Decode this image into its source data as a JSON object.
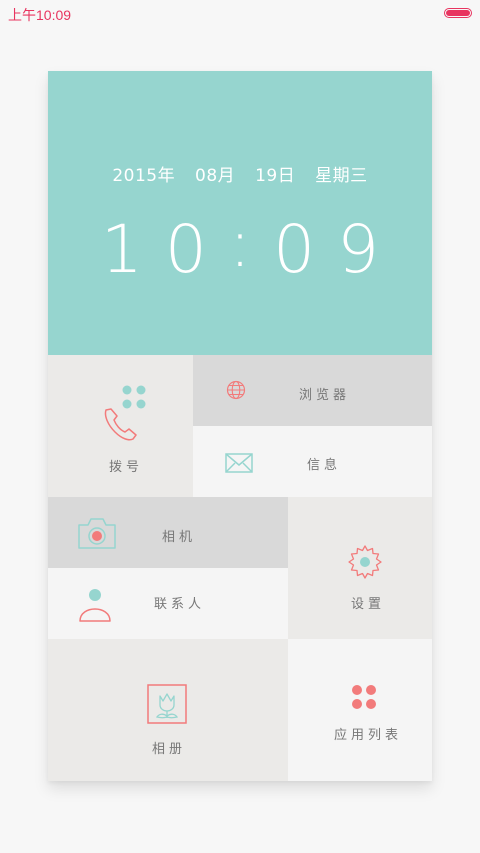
{
  "status_bar": {
    "time": "上午10:09",
    "battery_level": 1.0
  },
  "lock": {
    "year": "2015年",
    "month": "08月",
    "day": "19日",
    "weekday": "星期三",
    "hour": "10",
    "minute": "09"
  },
  "tiles": {
    "dial": "拨号",
    "browser": "浏览器",
    "messages": "信息",
    "camera": "相机",
    "settings": "设置",
    "contacts": "联系人",
    "gallery": "相册",
    "app_list": "应用列表"
  },
  "colors": {
    "accent_teal": "#96d5cf",
    "accent_coral": "#f27b7b",
    "status_pink": "#e8345f"
  }
}
